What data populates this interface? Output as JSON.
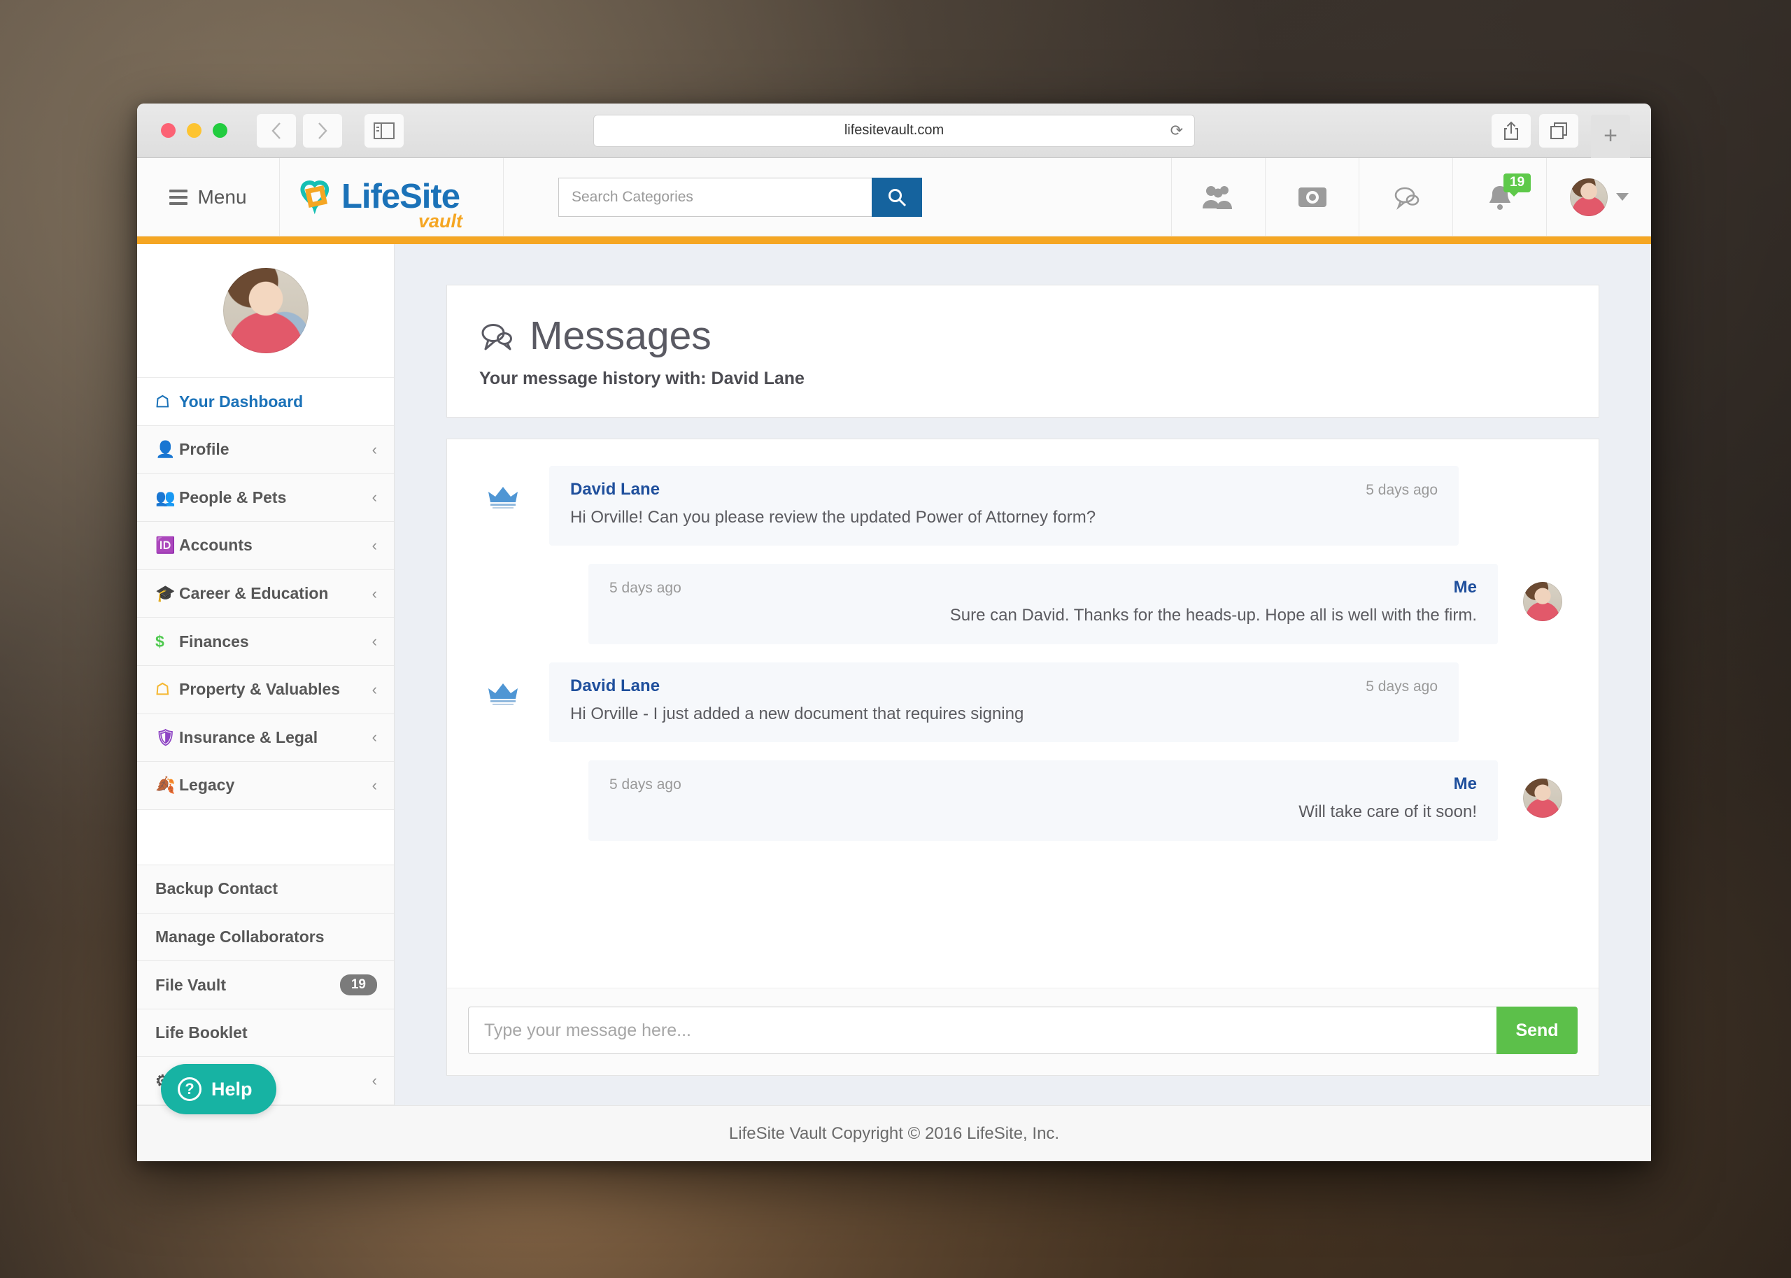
{
  "browser": {
    "url": "lifesitevault.com",
    "reload_icon": "reload-icon",
    "back_icon": "chevron-left-icon",
    "forward_icon": "chevron-right-icon",
    "sidebar_toggle_icon": "sidebar-toggle-icon",
    "share_icon": "share-icon",
    "tabs_icon": "tab-overview-icon",
    "new_tab_label": "+"
  },
  "header": {
    "menu_label": "Menu",
    "logo_text": "LifeSite",
    "logo_sub": "vault",
    "search_placeholder": "Search Categories",
    "search_value": "",
    "nav_icons": [
      {
        "name": "people-icon",
        "glyph": "👥"
      },
      {
        "name": "camera-icon",
        "glyph": "◉"
      },
      {
        "name": "messages-icon",
        "glyph": "💬"
      },
      {
        "name": "notifications-bell-icon",
        "glyph": "🔔"
      }
    ],
    "notification_count": "19",
    "accent_color": "#f5a623"
  },
  "sidebar": {
    "avatar_name": "user-avatar",
    "items": [
      {
        "label": "Your Dashboard",
        "icon": "home-icon",
        "glyph": "⌂",
        "color": "#1b72b8",
        "chevron": "",
        "active": true
      },
      {
        "label": "Profile",
        "icon": "person-icon",
        "glyph": "♟",
        "color": "#f0932b",
        "chevron": "‹",
        "active": false
      },
      {
        "label": "People & Pets",
        "icon": "people-pets-icon",
        "glyph": "♟",
        "color": "#3aa2dd",
        "chevron": "‹",
        "active": false
      },
      {
        "label": "Accounts",
        "icon": "accounts-card-icon",
        "glyph": "▤",
        "color": "#e96a6a",
        "chevron": "‹",
        "active": false
      },
      {
        "label": "Career & Education",
        "icon": "graduation-cap-icon",
        "glyph": "◢",
        "color": "#f0932b",
        "chevron": "‹",
        "active": false
      },
      {
        "label": "Finances",
        "icon": "dollar-icon",
        "glyph": "$",
        "color": "#4fc94f",
        "chevron": "‹",
        "active": false
      },
      {
        "label": "Property & Valuables",
        "icon": "house-icon",
        "glyph": "⌂",
        "color": "#f5b731",
        "chevron": "‹",
        "active": false
      },
      {
        "label": "Insurance & Legal",
        "icon": "shield-icon",
        "glyph": "▮",
        "color": "#8e44c4",
        "chevron": "‹",
        "active": false
      },
      {
        "label": "Legacy",
        "icon": "leaf-icon",
        "glyph": "◠",
        "color": "#e0473b",
        "chevron": "‹",
        "active": false
      }
    ],
    "secondary_items": [
      {
        "label": "Backup Contact",
        "count": ""
      },
      {
        "label": "Manage Collaborators",
        "count": ""
      },
      {
        "label": "File Vault",
        "count": "19"
      },
      {
        "label": "Life Booklet",
        "count": ""
      }
    ],
    "settings_row": {
      "icon": "gear-icon",
      "chevron": "‹"
    },
    "help_button": {
      "label": "Help",
      "icon": "question-mark-icon",
      "glyph": "?"
    }
  },
  "page": {
    "title": "Messages",
    "title_icon": "speech-bubbles-icon",
    "subtitle": "Your message history with: David Lane"
  },
  "thread": {
    "messages": [
      {
        "direction": "incoming",
        "sender": "David Lane",
        "timestamp": "5 days ago",
        "text": "Hi Orville! Can you please review the updated Power of Attorney form?",
        "avatar": "david-lane-crown-avatar"
      },
      {
        "direction": "outgoing",
        "sender": "Me",
        "timestamp": "5 days ago",
        "text": "Sure can David. Thanks for the heads-up. Hope all is well with the firm.",
        "avatar": "me-avatar"
      },
      {
        "direction": "incoming",
        "sender": "David Lane",
        "timestamp": "5 days ago",
        "text": "Hi Orville - I just added a new document that requires signing",
        "avatar": "david-lane-crown-avatar"
      },
      {
        "direction": "outgoing",
        "sender": "Me",
        "timestamp": "5 days ago",
        "text": "Will take care of it soon!",
        "avatar": "me-avatar"
      }
    ]
  },
  "composer": {
    "placeholder": "Type your message here...",
    "value": "",
    "send_label": "Send",
    "send_color": "#5cc04a"
  },
  "footer": {
    "text": "LifeSite Vault Copyright © 2016 LifeSite, Inc."
  }
}
